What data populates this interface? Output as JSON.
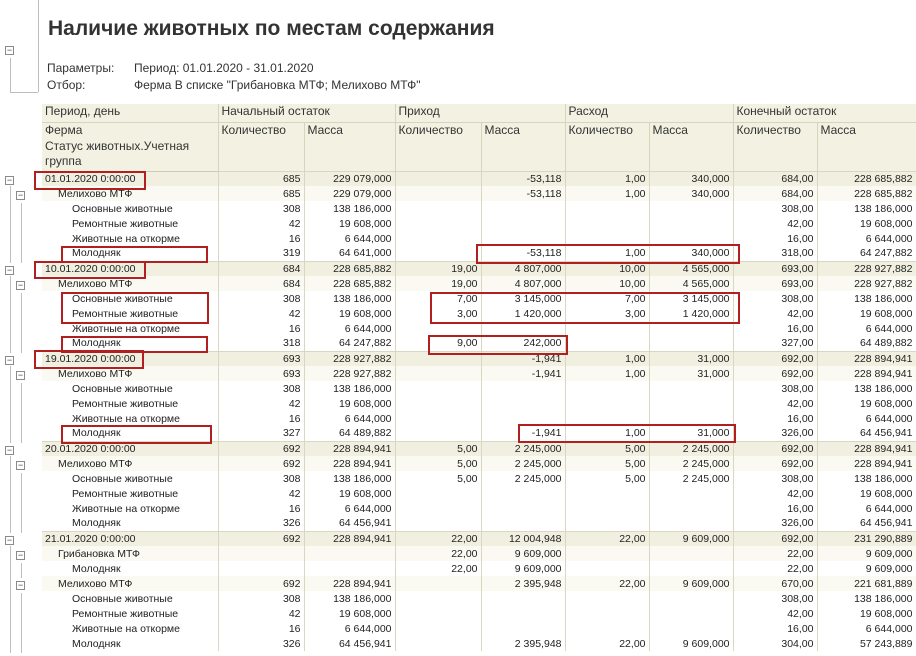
{
  "report": {
    "title": "Наличие животных по местам содержания",
    "params_label": "Параметры:",
    "params_value": "Период: 01.01.2020 - 31.01.2020",
    "filter_label": "Отбор:",
    "filter_value": "Ферма В списке \"Грибановка МТФ; Мелихово МТФ\""
  },
  "headers": {
    "row1": [
      "Период, день",
      "Начальный остаток",
      "Приход",
      "Расход",
      "Конечный остаток"
    ],
    "row2_farm": "Ферма",
    "row3_status": "Статус животных.Учетная группа",
    "qty": "Количество",
    "mass": "Масса"
  },
  "rows": [
    {
      "level": "date",
      "label": "01.01.2020 0:00:00",
      "cells": [
        "685",
        "229 079,000",
        "",
        "-53,118",
        "1,00",
        "340,000",
        "684,00",
        "228 685,882"
      ]
    },
    {
      "level": "farm",
      "label": "Мелихово МТФ",
      "cells": [
        "685",
        "229 079,000",
        "",
        "-53,118",
        "1,00",
        "340,000",
        "684,00",
        "228 685,882"
      ]
    },
    {
      "level": "item",
      "label": "Основные животные",
      "cells": [
        "308",
        "138 186,000",
        "",
        "",
        "",
        "",
        "308,00",
        "138 186,000"
      ]
    },
    {
      "level": "item",
      "label": "Ремонтные животные",
      "cells": [
        "42",
        "19 608,000",
        "",
        "",
        "",
        "",
        "42,00",
        "19 608,000"
      ]
    },
    {
      "level": "item",
      "label": "Животные на откорме",
      "cells": [
        "16",
        "6 644,000",
        "",
        "",
        "",
        "",
        "16,00",
        "6 644,000"
      ]
    },
    {
      "level": "item",
      "label": "Молодняк",
      "cells": [
        "319",
        "64 641,000",
        "",
        "-53,118",
        "1,00",
        "340,000",
        "318,00",
        "64 247,882"
      ]
    },
    {
      "level": "date",
      "label": "10.01.2020 0:00:00",
      "cells": [
        "684",
        "228 685,882",
        "19,00",
        "4 807,000",
        "10,00",
        "4 565,000",
        "693,00",
        "228 927,882"
      ]
    },
    {
      "level": "farm",
      "label": "Мелихово МТФ",
      "cells": [
        "684",
        "228 685,882",
        "19,00",
        "4 807,000",
        "10,00",
        "4 565,000",
        "693,00",
        "228 927,882"
      ]
    },
    {
      "level": "item",
      "label": "Основные животные",
      "cells": [
        "308",
        "138 186,000",
        "7,00",
        "3 145,000",
        "7,00",
        "3 145,000",
        "308,00",
        "138 186,000"
      ]
    },
    {
      "level": "item",
      "label": "Ремонтные животные",
      "cells": [
        "42",
        "19 608,000",
        "3,00",
        "1 420,000",
        "3,00",
        "1 420,000",
        "42,00",
        "19 608,000"
      ]
    },
    {
      "level": "item",
      "label": "Животные на откорме",
      "cells": [
        "16",
        "6 644,000",
        "",
        "",
        "",
        "",
        "16,00",
        "6 644,000"
      ]
    },
    {
      "level": "item",
      "label": "Молодняк",
      "cells": [
        "318",
        "64 247,882",
        "9,00",
        "242,000",
        "",
        "",
        "327,00",
        "64 489,882"
      ]
    },
    {
      "level": "date",
      "label": "19.01.2020 0:00:00",
      "cells": [
        "693",
        "228 927,882",
        "",
        "-1,941",
        "1,00",
        "31,000",
        "692,00",
        "228 894,941"
      ]
    },
    {
      "level": "farm",
      "label": "Мелихово МТФ",
      "cells": [
        "693",
        "228 927,882",
        "",
        "-1,941",
        "1,00",
        "31,000",
        "692,00",
        "228 894,941"
      ]
    },
    {
      "level": "item",
      "label": "Основные животные",
      "cells": [
        "308",
        "138 186,000",
        "",
        "",
        "",
        "",
        "308,00",
        "138 186,000"
      ]
    },
    {
      "level": "item",
      "label": "Ремонтные животные",
      "cells": [
        "42",
        "19 608,000",
        "",
        "",
        "",
        "",
        "42,00",
        "19 608,000"
      ]
    },
    {
      "level": "item",
      "label": "Животные на откорме",
      "cells": [
        "16",
        "6 644,000",
        "",
        "",
        "",
        "",
        "16,00",
        "6 644,000"
      ]
    },
    {
      "level": "item",
      "label": "Молодняк",
      "cells": [
        "327",
        "64 489,882",
        "",
        "-1,941",
        "1,00",
        "31,000",
        "326,00",
        "64 456,941"
      ]
    },
    {
      "level": "date",
      "label": "20.01.2020 0:00:00",
      "cells": [
        "692",
        "228 894,941",
        "5,00",
        "2 245,000",
        "5,00",
        "2 245,000",
        "692,00",
        "228 894,941"
      ]
    },
    {
      "level": "farm",
      "label": "Мелихово МТФ",
      "cells": [
        "692",
        "228 894,941",
        "5,00",
        "2 245,000",
        "5,00",
        "2 245,000",
        "692,00",
        "228 894,941"
      ]
    },
    {
      "level": "item",
      "label": "Основные животные",
      "cells": [
        "308",
        "138 186,000",
        "5,00",
        "2 245,000",
        "5,00",
        "2 245,000",
        "308,00",
        "138 186,000"
      ]
    },
    {
      "level": "item",
      "label": "Ремонтные животные",
      "cells": [
        "42",
        "19 608,000",
        "",
        "",
        "",
        "",
        "42,00",
        "19 608,000"
      ]
    },
    {
      "level": "item",
      "label": "Животные на откорме",
      "cells": [
        "16",
        "6 644,000",
        "",
        "",
        "",
        "",
        "16,00",
        "6 644,000"
      ]
    },
    {
      "level": "item",
      "label": "Молодняк",
      "cells": [
        "326",
        "64 456,941",
        "",
        "",
        "",
        "",
        "326,00",
        "64 456,941"
      ]
    },
    {
      "level": "date",
      "label": "21.01.2020 0:00:00",
      "cells": [
        "692",
        "228 894,941",
        "22,00",
        "12 004,948",
        "22,00",
        "9 609,000",
        "692,00",
        "231 290,889"
      ]
    },
    {
      "level": "farm",
      "label": "Грибановка МТФ",
      "cells": [
        "",
        "",
        "22,00",
        "9 609,000",
        "",
        "",
        "22,00",
        "9 609,000"
      ]
    },
    {
      "level": "item",
      "label": "Молодняк",
      "cells": [
        "",
        "",
        "22,00",
        "9 609,000",
        "",
        "",
        "22,00",
        "9 609,000"
      ]
    },
    {
      "level": "farm",
      "label": "Мелихово МТФ",
      "cells": [
        "692",
        "228 894,941",
        "",
        "2 395,948",
        "22,00",
        "9 609,000",
        "670,00",
        "221 681,889"
      ]
    },
    {
      "level": "item",
      "label": "Основные животные",
      "cells": [
        "308",
        "138 186,000",
        "",
        "",
        "",
        "",
        "308,00",
        "138 186,000"
      ]
    },
    {
      "level": "item",
      "label": "Ремонтные животные",
      "cells": [
        "42",
        "19 608,000",
        "",
        "",
        "",
        "",
        "42,00",
        "19 608,000"
      ]
    },
    {
      "level": "item",
      "label": "Животные на откорме",
      "cells": [
        "16",
        "6 644,000",
        "",
        "",
        "",
        "",
        "16,00",
        "6 644,000"
      ]
    },
    {
      "level": "item",
      "label": "Молодняк",
      "cells": [
        "326",
        "64 456,941",
        "",
        "2 395,948",
        "22,00",
        "9 609,000",
        "304,00",
        "57 243,889"
      ]
    }
  ],
  "colors": {
    "highlight": "#b21f1f",
    "header_bg": "#f3f2e2",
    "group_bg": "#f1f0e0"
  }
}
